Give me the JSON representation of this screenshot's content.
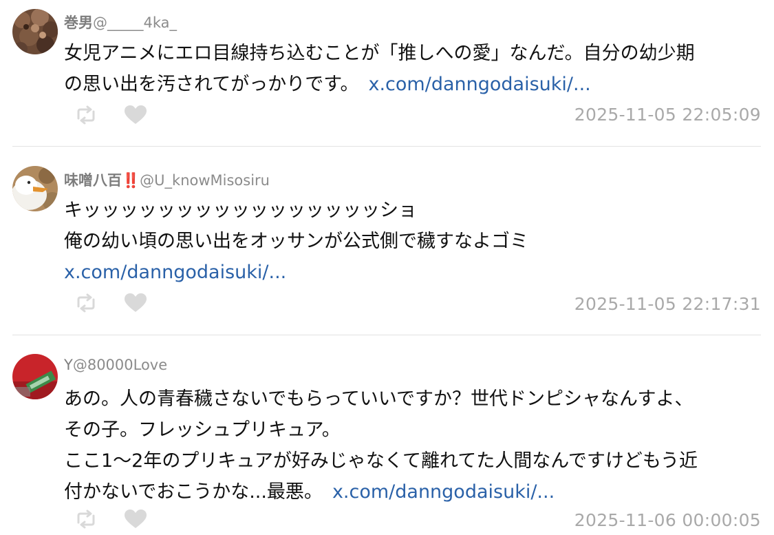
{
  "posts": [
    {
      "display_name": "巻男",
      "handle": "@_____4ka_",
      "text_lines": [
        "女児アニメにエロ目線持ち込むことが「推しへの愛」なんだ。自分の幼少期",
        "の思い出を汚されてがっかりです。"
      ],
      "link": "x.com/danngodaisuki/...",
      "timestamp": "2025-11-05 22:05:09",
      "avatar_icon": "brown-fur-avatar"
    },
    {
      "display_name": "味噌八百",
      "badge": "‼️",
      "handle": "@U_knowMisosiru",
      "text_lines": [
        "キッッッッッッッッッッッッッッッッショ",
        "俺の幼い頃の思い出をオッサンが公式側で穢すなよゴミ"
      ],
      "link": "x.com/danngodaisuki/...",
      "timestamp": "2025-11-05 22:17:31",
      "avatar_icon": "duck-avatar"
    },
    {
      "display_name": "Y",
      "handle": "@80000Love",
      "text_lines": [
        "あの。人の青春穢さないでもらっていいですか？世代ドンピシャなんすよ、",
        "その子。フレッシュプリキュア。",
        "ここ1〜2年のプリキュアが好みじゃなくて離れてた人間なんですけどもう近",
        "付かないでおこうかな...最悪。"
      ],
      "link": "x.com/danngodaisuki/...",
      "timestamp": "2025-11-06 00:00:05",
      "avatar_icon": "red-sign-avatar"
    }
  ],
  "icons": {
    "retweet": "retweet-icon",
    "like": "heart-icon"
  },
  "colors": {
    "link": "#2a61a8",
    "meta_text": "#8b8b8b",
    "timestamp": "#a9a9a9",
    "action_icon": "#d9d9d9",
    "divider": "#e2e2e2"
  }
}
